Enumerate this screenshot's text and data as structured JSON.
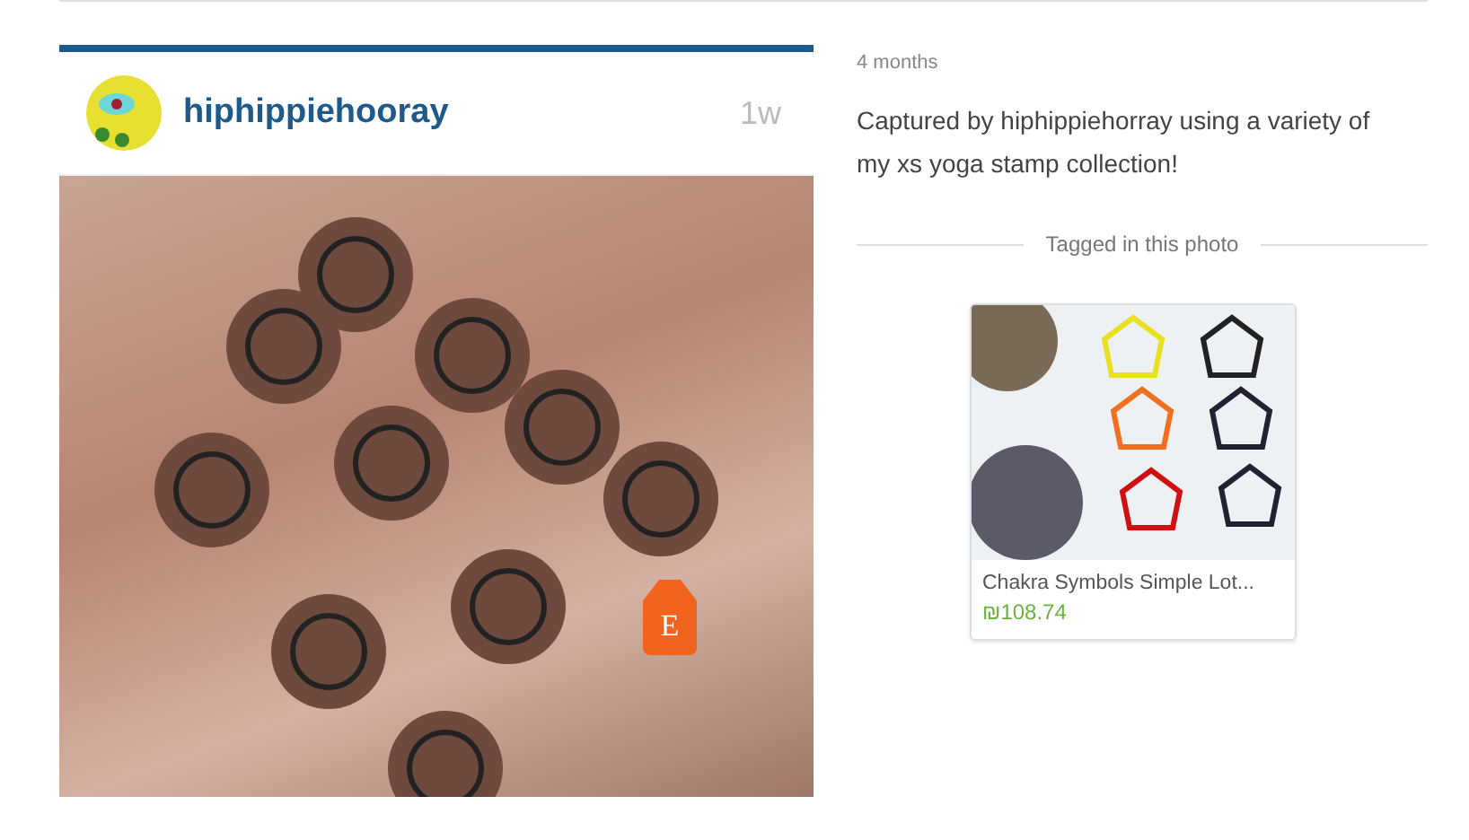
{
  "post": {
    "username": "hiphippiehooray",
    "age": "1w",
    "tag_letter": "E"
  },
  "details": {
    "time": "4 months",
    "caption": "Captured by hiphippiehorray using a variety of my xs yoga stamp collection!",
    "tagged_heading": "Tagged in this photo",
    "items": [
      {
        "title": "Chakra Symbols Simple Lot...",
        "price": "₪108.74"
      }
    ]
  }
}
